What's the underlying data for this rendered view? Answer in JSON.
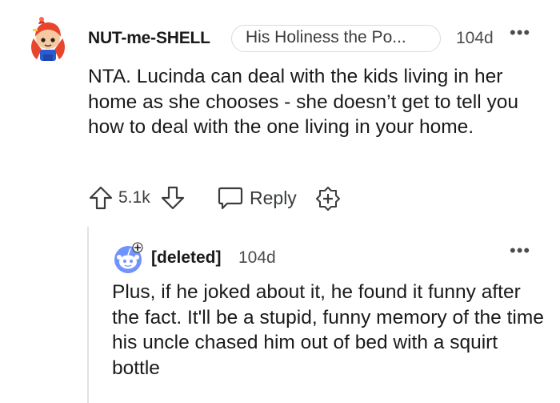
{
  "comment": {
    "username": "NUT-me-SHELL",
    "flair": "His Holiness the Po...",
    "timestamp": "104d",
    "more_label": "•••",
    "body": "NTA. Lucinda can deal with the kids living in her home as she chooses - she doesn’t get to tell you how to deal with the one living in your home.",
    "vote_count": "5.1k",
    "reply_label": "Reply",
    "avatar_icon": "snoo-red-hair-avatar-icon",
    "colors": {
      "hair": "#e8452c",
      "shirt": "#2a5cd6",
      "face": "#f6c9a0"
    }
  },
  "reply": {
    "username": "[deleted]",
    "timestamp": "104d",
    "more_label": "•••",
    "body": "Plus, if he joked about it, he found it funny after the fact. It'll be a stupid, funny memory of the time his uncle chased him out of bed with a squirt bottle",
    "avatar_icon": "default-snoo-avatar-icon",
    "colors": {
      "avatar_bg": "#7193ff"
    }
  }
}
